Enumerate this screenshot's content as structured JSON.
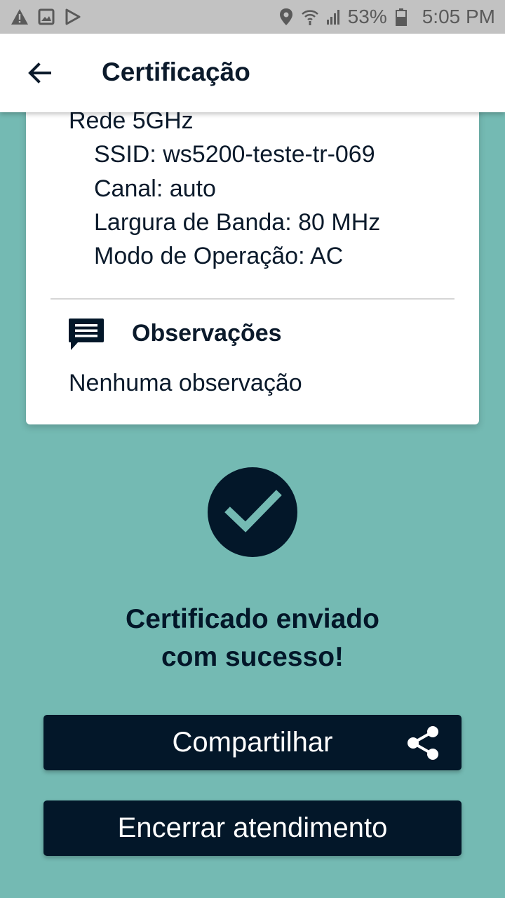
{
  "status_bar": {
    "left_icons": [
      "warning-icon",
      "image-icon",
      "play-store-icon"
    ],
    "right_icons": [
      "location-icon",
      "wifi-icon",
      "signal-icon",
      "battery-icon"
    ],
    "battery": "53%",
    "time": "5:05 PM"
  },
  "app_bar": {
    "title": "Certificação",
    "back_icon": "arrow-left-icon"
  },
  "card": {
    "network_title": "Rede 5GHz",
    "ssid": "SSID: ws5200-teste-tr-069",
    "channel": "Canal: auto",
    "bandwidth": "Largura de Banda: 80 MHz",
    "mode": "Modo de Operação: AC",
    "observations_title": "Observações",
    "observations_icon": "comment-icon",
    "observations_text": "Nenhuma observação"
  },
  "success": {
    "icon": "check-icon",
    "line1": "Certificado enviado",
    "line2": "com sucesso!"
  },
  "buttons": {
    "share_label": "Compartilhar",
    "share_icon": "share-icon",
    "end_label": "Encerrar atendimento"
  },
  "colors": {
    "background": "#74bab3",
    "primary_dark": "#031729",
    "card": "#ffffff",
    "status_bar": "#c2c2c2"
  }
}
